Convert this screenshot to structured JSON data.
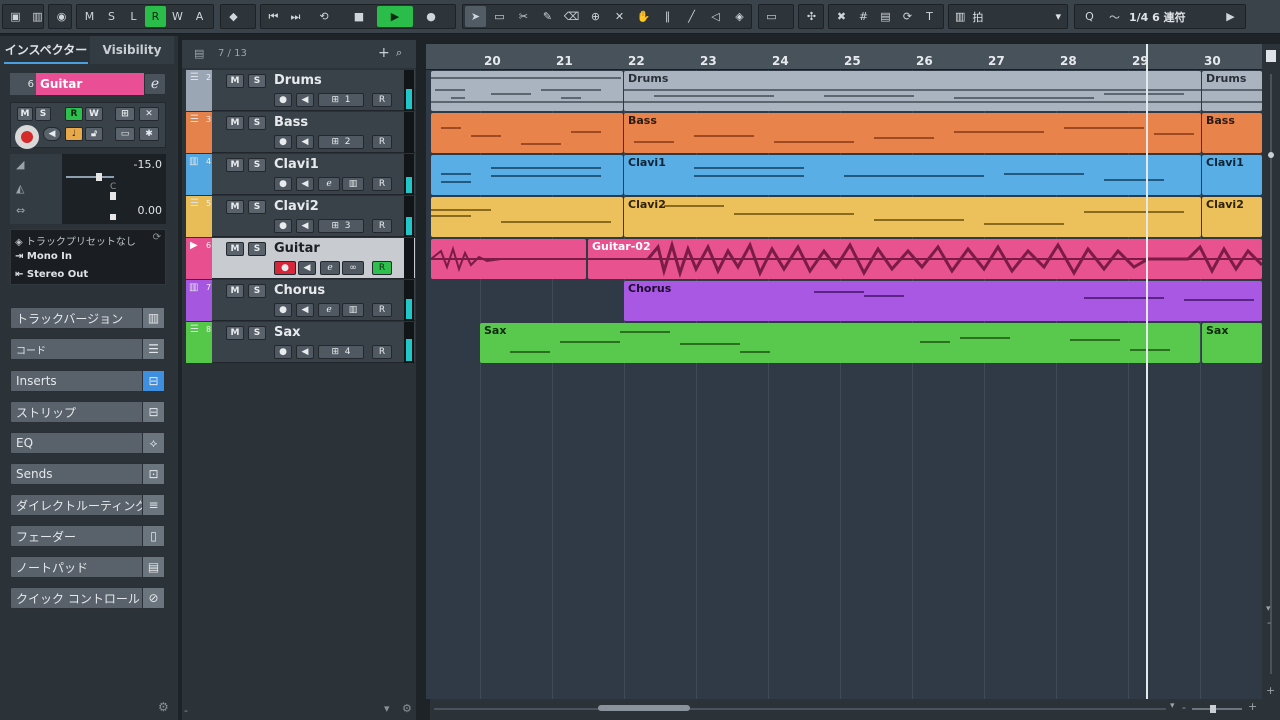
{
  "toolbar": {
    "msrw": [
      "M",
      "S",
      "L",
      "R",
      "W",
      "A"
    ],
    "quantize_label": "Q",
    "grid_label": "拍",
    "quantize_value": "1/4 6 連符"
  },
  "inspector": {
    "tab_inspector": "インスペクター",
    "tab_visibility": "Visibility",
    "track_number": "6",
    "track_name": "Guitar",
    "volume": "-15.0",
    "pan_label": "C",
    "pan_value": "0.00",
    "preset": "トラックプリセットなし",
    "input": "Mono In",
    "output": "Stereo Out",
    "sections": [
      "トラックバージョン",
      "コード",
      "Inserts",
      "ストリップ",
      "EQ",
      "Sends",
      "ダイレクトルーティング",
      "フェーダー",
      "ノートパッド",
      "クイック コントロール"
    ]
  },
  "tracklist": {
    "count": "7 / 13",
    "tracks": [
      {
        "num": "2",
        "name": "Drums",
        "channel": "1",
        "color": "#9aa6b4"
      },
      {
        "num": "3",
        "name": "Bass",
        "channel": "2",
        "color": "#e5814a"
      },
      {
        "num": "4",
        "name": "Clavi1",
        "channel": "",
        "color": "#52a7e0"
      },
      {
        "num": "5",
        "name": "Clavi2",
        "channel": "3",
        "color": "#e8bd57"
      },
      {
        "num": "6",
        "name": "Guitar",
        "channel": "",
        "color": "#e84f8f"
      },
      {
        "num": "7",
        "name": "Chorus",
        "channel": "",
        "color": "#a657e0"
      },
      {
        "num": "8",
        "name": "Sax",
        "channel": "4",
        "color": "#55c84a"
      }
    ]
  },
  "ruler": {
    "bars": [
      "20",
      "21",
      "22",
      "23",
      "24",
      "25",
      "26",
      "27",
      "28",
      "29",
      "30"
    ]
  },
  "parts": {
    "drums_a": "Drums",
    "drums_b": "Drums",
    "bass_a": "Bass",
    "bass_b": "Bass",
    "clavi1_a": "Clavi1",
    "clavi1_b": "Clavi1",
    "clavi2_a": "Clavi2",
    "clavi2_b": "Clavi2",
    "guitar": "Guitar-02",
    "chorus": "Chorus",
    "sax_a": "Sax",
    "sax_b": "Sax"
  }
}
